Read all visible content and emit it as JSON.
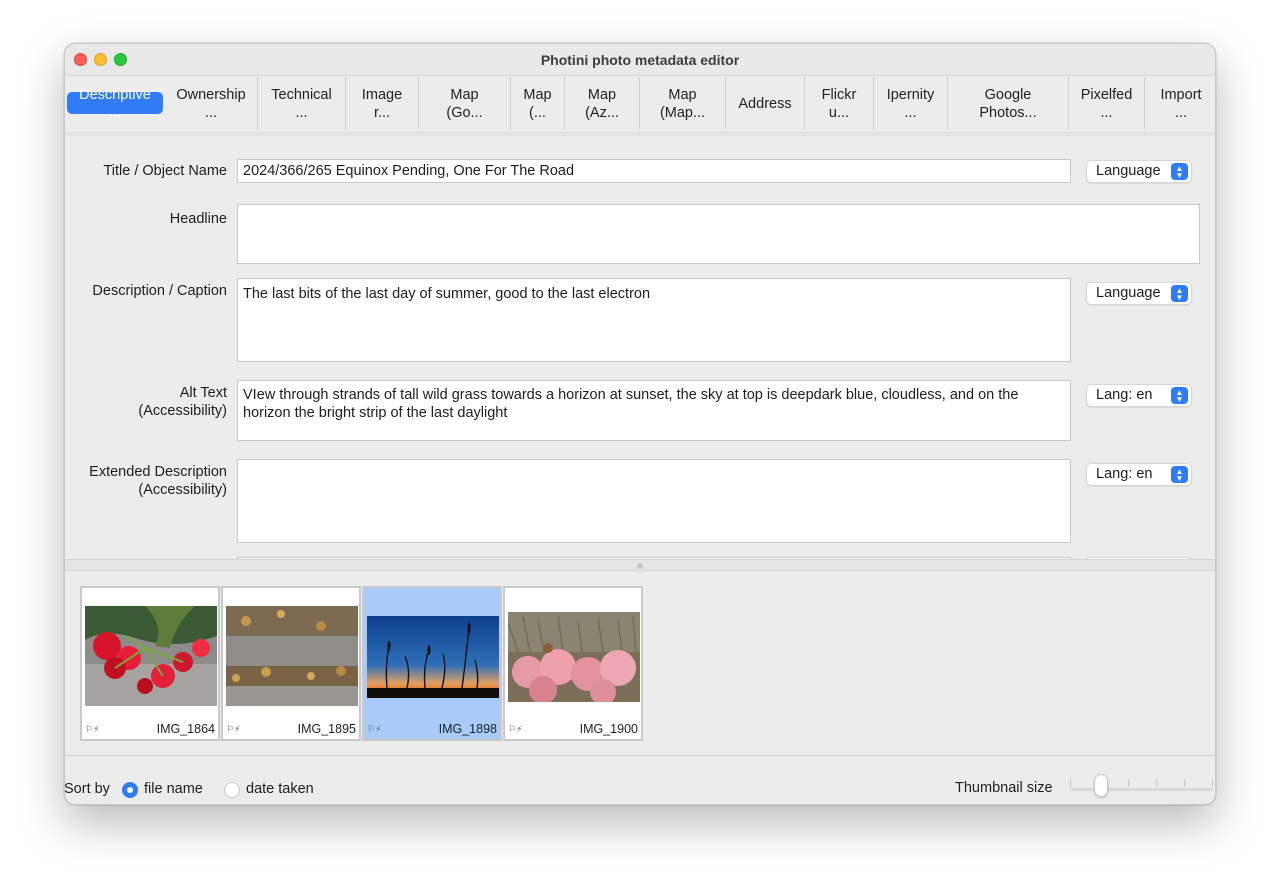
{
  "window": {
    "title": "Photini photo metadata editor"
  },
  "tabs": [
    {
      "l1": "Descriptive",
      "l2": "..."
    },
    {
      "l1": "Ownership",
      "l2": "..."
    },
    {
      "l1": "Technical",
      "l2": "..."
    },
    {
      "l1": "Image",
      "l2": "r..."
    },
    {
      "l1": "Map",
      "l2": "(Go..."
    },
    {
      "l1": "Map",
      "l2": "(..."
    },
    {
      "l1": "Map",
      "l2": "(Az..."
    },
    {
      "l1": "Map",
      "l2": "(Map..."
    },
    {
      "l1": "Address",
      "l2": ""
    },
    {
      "l1": "Flickr",
      "l2": "u..."
    },
    {
      "l1": "Ipernity",
      "l2": "..."
    },
    {
      "l1": "Google",
      "l2": "Photos..."
    },
    {
      "l1": "Pixelfed",
      "l2": "..."
    },
    {
      "l1": "Import",
      "l2": "..."
    }
  ],
  "form": {
    "title": {
      "label": "Title / Object Name",
      "value": "2024/366/265 Equinox Pending, One For The Road",
      "lang": "Language"
    },
    "headline": {
      "label": "Headline",
      "value": ""
    },
    "description": {
      "label": "Description / Caption",
      "value": "The last bits of the last day of summer, good to the last electron",
      "lang": "Language"
    },
    "alt_text": {
      "label1": "Alt Text",
      "label2": "(Accessibility)",
      "value": "VIew through strands of tall wild grass towards a horizon at sunset, the sky at top is deepdark blue, cloudless, and on the horizon the bright strip of the last daylight",
      "lang": "Lang: en"
    },
    "extended": {
      "label1": "Extended Description",
      "label2": "(Accessibility)",
      "value": "",
      "lang": "Lang: en"
    }
  },
  "thumbnails": [
    {
      "name": "IMG_1864",
      "flags": "⚐⚡",
      "selected": false
    },
    {
      "name": "IMG_1895",
      "flags": "⚐⚡",
      "selected": false
    },
    {
      "name": "IMG_1898",
      "flags": "⚐⚡",
      "selected": true
    },
    {
      "name": "IMG_1900",
      "flags": "⚐⚡",
      "selected": false
    }
  ],
  "bottom": {
    "sort_label": "Sort by",
    "sort_options": [
      "file name",
      "date taken"
    ],
    "sort_selected": "file name",
    "size_label": "Thumbnail size"
  },
  "colors": {
    "accent": "#2f7cf6",
    "selection": "#a8cbfb"
  }
}
